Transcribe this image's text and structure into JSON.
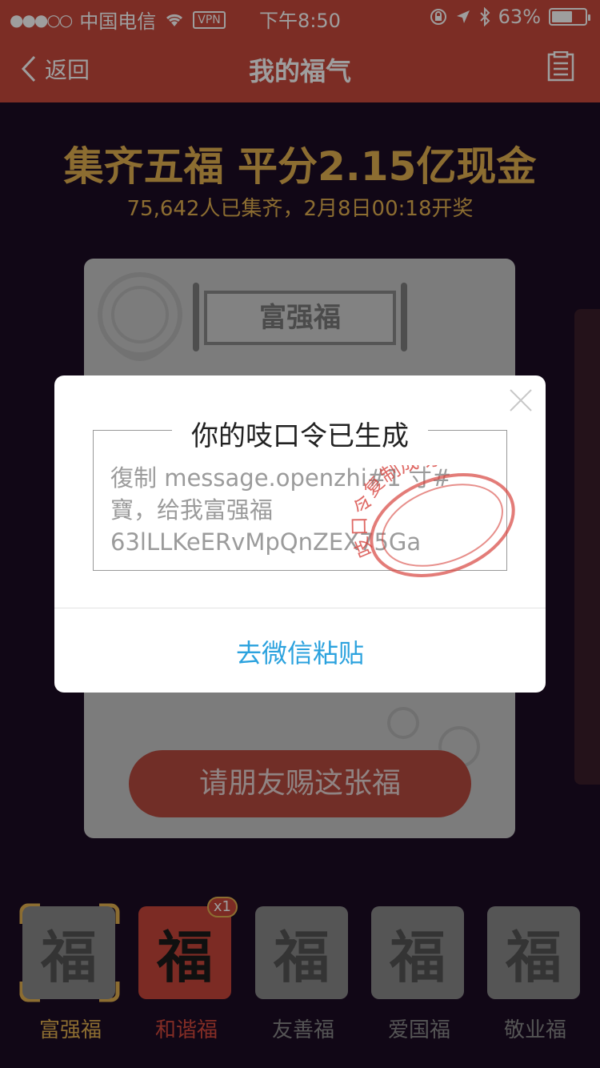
{
  "status_bar": {
    "signal_dots": "●●●○○",
    "carrier": "中国电信",
    "vpn": "VPN",
    "time": "下午8:50",
    "battery": "63%",
    "battery_level": 0.63
  },
  "nav": {
    "back_label": "返回",
    "title": "我的福气"
  },
  "header": {
    "headline": "集齐五福 平分2.15亿现金",
    "subline": "75,642人已集齐，2月8日00:18开奖"
  },
  "card": {
    "scroll_title": "富强福",
    "give_button": "请朋友赐这张福"
  },
  "modal": {
    "title": "你的吱口令已生成",
    "code_line1": "復制 message.openzhi#1  寸#",
    "code_line2": "寶，给我富强福",
    "code_line3": "63lLLKeERvMpQnZEX75Ga",
    "stamp_text": "吱口令复制成功",
    "action": "去微信粘贴"
  },
  "fu_tabs": [
    {
      "glyph": "福",
      "label": "富强福",
      "selected": true,
      "count": ""
    },
    {
      "glyph": "福",
      "label": "和谐福",
      "selected": false,
      "count": "x1"
    },
    {
      "glyph": "福",
      "label": "友善福",
      "selected": false,
      "count": ""
    },
    {
      "glyph": "福",
      "label": "爱国福",
      "selected": false,
      "count": ""
    },
    {
      "glyph": "福",
      "label": "敬业福",
      "selected": false,
      "count": ""
    }
  ],
  "colors": {
    "brand_red": "#c84a3c",
    "gold": "#e2b04f",
    "link_blue": "#2ba2de",
    "background": "#1c0c25"
  }
}
